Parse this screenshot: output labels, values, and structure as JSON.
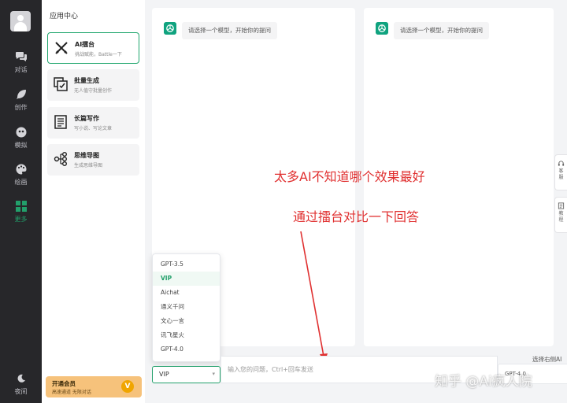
{
  "rail": {
    "items": [
      {
        "label": "对话",
        "icon": "chat-icon"
      },
      {
        "label": "创作",
        "icon": "feather-icon"
      },
      {
        "label": "模拟",
        "icon": "mask-icon"
      },
      {
        "label": "绘画",
        "icon": "palette-icon"
      },
      {
        "label": "更多",
        "icon": "grid-icon",
        "active": true
      }
    ],
    "bottom_label": "夜间"
  },
  "apps": {
    "title": "应用中心",
    "cards": [
      {
        "name": "AI擂台",
        "desc": "挑战赋能，Battle一下",
        "icon": "swords-icon",
        "active": true
      },
      {
        "name": "批量生成",
        "desc": "无人值守批量创作",
        "icon": "batch-icon"
      },
      {
        "name": "长篇写作",
        "desc": "写小说、写论文章",
        "icon": "book-icon"
      },
      {
        "name": "思维导图",
        "desc": "生成思维导图",
        "icon": "mindmap-icon"
      }
    ],
    "vip": {
      "title": "开通会员",
      "desc": "高速通道 无限对话",
      "badge": "V"
    }
  },
  "panels": {
    "left_greeting": "请选择一个模型，开始你的提问",
    "right_greeting": "请选择一个模型，开始你的提问"
  },
  "side_tabs": [
    {
      "label": "客服",
      "icon": "support-icon"
    },
    {
      "label": "教程",
      "icon": "doc-icon"
    }
  ],
  "annotations": {
    "line1": "太多AI不知道哪个效果最好",
    "line2": "通过擂台对比一下回答"
  },
  "dropdown": {
    "options": [
      "GPT-3.5",
      "VIP",
      "Aichat",
      "通义千问",
      "文心一言",
      "讯飞星火",
      "GPT-4.0"
    ],
    "selected": "VIP"
  },
  "input": {
    "model_value": "VIP",
    "placeholder": "输入您的问题，Ctrl+回车发送",
    "right_value": "GPT-4.0",
    "right_hint": "选择右侧AI"
  },
  "watermark": "知乎 @Ai疯人院",
  "colors": {
    "accent": "#22a06b",
    "annotation": "#e03030",
    "rail": "#27272a"
  }
}
